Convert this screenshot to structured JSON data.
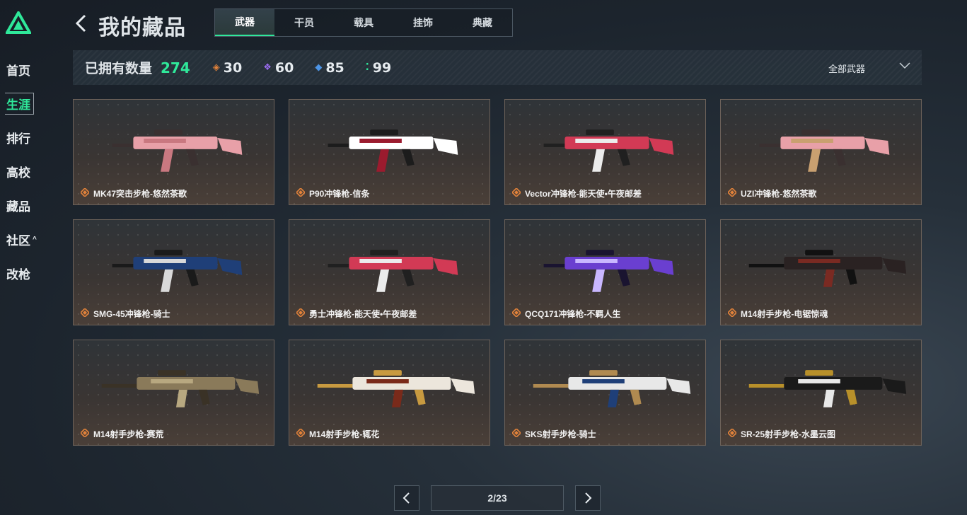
{
  "app": {
    "logo": "logo-icon"
  },
  "sidebar": {
    "items": [
      {
        "label": "首页"
      },
      {
        "label": "生涯",
        "active": true
      },
      {
        "label": "排行"
      },
      {
        "label": "高校"
      },
      {
        "label": "藏品"
      },
      {
        "label": "社区",
        "caret": "^"
      },
      {
        "label": "改枪"
      }
    ]
  },
  "header": {
    "title": "我的藏品",
    "tabs": [
      {
        "label": "武器",
        "active": true
      },
      {
        "label": "干员"
      },
      {
        "label": "载具"
      },
      {
        "label": "挂饰"
      },
      {
        "label": "典藏"
      }
    ]
  },
  "stats": {
    "owned_label": "已拥有数量",
    "owned_count": "274",
    "rarities": [
      {
        "icon": "orange-diamond-icon",
        "color": "#e2823a",
        "count": "30"
      },
      {
        "icon": "purple-diamond-icon",
        "color": "#9a6cf0",
        "count": "60"
      },
      {
        "icon": "blue-diamond-icon",
        "color": "#4c94e6",
        "count": "85"
      },
      {
        "icon": "green-dots-icon",
        "color": "#2fe89a",
        "count": "99"
      }
    ],
    "filter_label": "全部武器"
  },
  "items": [
    {
      "name": "MK47突击步枪-悠然茶歌",
      "rarity": "orange",
      "palette": [
        "#e8a0a8",
        "#c97880",
        "#3a3030"
      ]
    },
    {
      "name": "P90冲锋枪-信条",
      "rarity": "orange",
      "palette": [
        "#ffffff",
        "#9b1b2e",
        "#1c1c1c"
      ]
    },
    {
      "name": "Vector冲锋枪-能天使•午夜邮差",
      "rarity": "orange",
      "palette": [
        "#d23a55",
        "#ececec",
        "#202020"
      ]
    },
    {
      "name": "UZI冲锋枪-悠然茶歌",
      "rarity": "orange",
      "palette": [
        "#e8a0a8",
        "#c9a070",
        "#3a3030"
      ]
    },
    {
      "name": "SMG-45冲锋枪-骑士",
      "rarity": "orange",
      "palette": [
        "#1f3f78",
        "#d9d9d9",
        "#1a1a1a"
      ]
    },
    {
      "name": "勇士冲锋枪-能天使•午夜邮差",
      "rarity": "orange",
      "palette": [
        "#d23a55",
        "#ececec",
        "#202020"
      ]
    },
    {
      "name": "QCQ171冲锋枪-不羁人生",
      "rarity": "orange",
      "palette": [
        "#6a3fd0",
        "#c9b7ff",
        "#1a1430"
      ]
    },
    {
      "name": "M14射手步枪-电锯惊魂",
      "rarity": "orange",
      "palette": [
        "#2a2222",
        "#7a2a22",
        "#111111"
      ]
    },
    {
      "name": "M14射手步枪-赛荒",
      "rarity": "orange",
      "palette": [
        "#8a7a5a",
        "#b8a880",
        "#3a3226"
      ]
    },
    {
      "name": "M14射手步枪-辄花",
      "rarity": "orange",
      "palette": [
        "#ece6dc",
        "#7a2a1a",
        "#c89a40"
      ]
    },
    {
      "name": "SKS射手步枪-骑士",
      "rarity": "orange",
      "palette": [
        "#e8e8e8",
        "#1f3f78",
        "#b08a50"
      ]
    },
    {
      "name": "SR-25射手步枪-水墨云图",
      "rarity": "orange",
      "palette": [
        "#1a1a1a",
        "#e8e8e8",
        "#b8902a"
      ]
    }
  ],
  "pager": {
    "prev": "prev-page-icon",
    "text": "2/23",
    "next": "next-page-icon"
  }
}
